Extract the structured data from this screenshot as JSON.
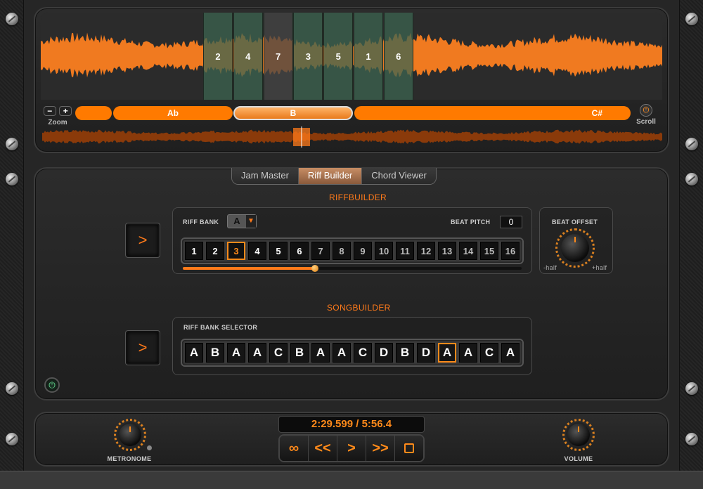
{
  "waveform": {
    "segments": [
      {
        "label": "2",
        "style": "green"
      },
      {
        "label": "4",
        "style": "green"
      },
      {
        "label": "7",
        "style": "gray"
      },
      {
        "label": "3",
        "style": "green"
      },
      {
        "label": "5",
        "style": "green"
      },
      {
        "label": "1",
        "style": "green"
      },
      {
        "label": "6",
        "style": "green"
      }
    ]
  },
  "zoom": {
    "minus": "−",
    "plus": "+",
    "label": "Zoom"
  },
  "scroll": {
    "icon": "⏻",
    "label": "Scroll"
  },
  "keys": [
    {
      "label": ""
    },
    {
      "label": "Ab"
    },
    {
      "label": "B",
      "selected": true
    },
    {
      "label": "C#"
    }
  ],
  "tabs": [
    {
      "label": "Jam Master",
      "active": false
    },
    {
      "label": "Riff Builder",
      "active": true
    },
    {
      "label": "Chord Viewer",
      "active": false
    }
  ],
  "riffbuilder": {
    "title": "RIFFBUILDER",
    "play_label": ">",
    "riff_bank_label": "RIFF BANK",
    "riff_bank_value": "A",
    "dropdown_arrow": "▼",
    "beat_pitch_label": "BEAT PITCH",
    "beat_pitch_value": "0",
    "cells": [
      "1",
      "2",
      "3",
      "4",
      "5",
      "6",
      "7",
      "8",
      "9",
      "10",
      "11",
      "12",
      "13",
      "14",
      "15",
      "16"
    ],
    "selected_index": 2,
    "bright_count": 6,
    "progress": 0.39
  },
  "beat_offset": {
    "label": "BEAT OFFSET",
    "min_label": "-half",
    "max_label": "+half"
  },
  "songbuilder": {
    "title": "SONGBUILDER",
    "play_label": ">",
    "selector_label": "RIFF BANK SELECTOR",
    "cells": [
      "A",
      "B",
      "A",
      "A",
      "C",
      "B",
      "A",
      "A",
      "C",
      "D",
      "B",
      "D",
      "A",
      "A",
      "C",
      "A"
    ],
    "selected_index": 12
  },
  "transport": {
    "time": "2:29.599 / 5:56.4",
    "loop": "∞",
    "rewind": "<<",
    "play": ">",
    "forward": ">>"
  },
  "metronome": {
    "label": "METRONOME"
  },
  "volume": {
    "label": "VOLUME"
  },
  "colors": {
    "accent": "#ff7a00",
    "segment_green": "#3c6450",
    "segment_gray": "#464646"
  }
}
